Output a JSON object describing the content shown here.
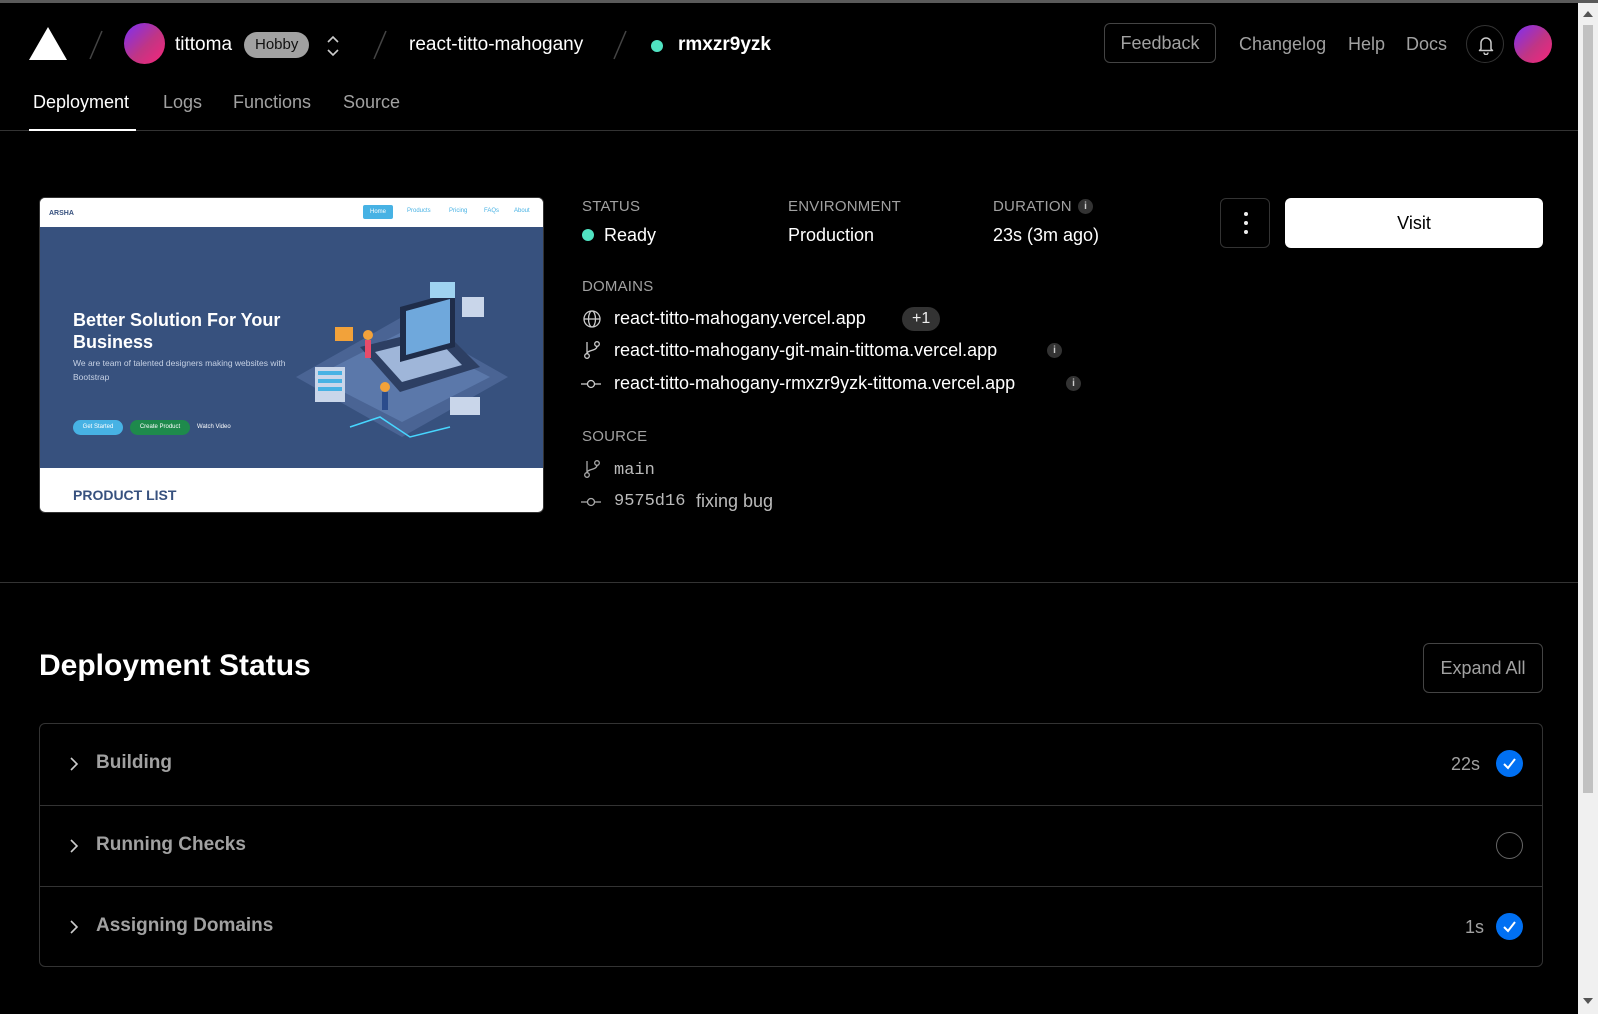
{
  "header": {
    "team": "tittoma",
    "plan_badge": "Hobby",
    "project": "react-titto-mahogany",
    "deployment_id": "rmxzr9yzk",
    "links": {
      "feedback": "Feedback",
      "changelog": "Changelog",
      "help": "Help",
      "docs": "Docs"
    }
  },
  "tabs": [
    "Deployment",
    "Logs",
    "Functions",
    "Source"
  ],
  "preview": {
    "brand": "ARSHA",
    "nav": [
      "Home",
      "Products",
      "Pricing",
      "FAQs",
      "About"
    ],
    "headline": "Better Solution For Your Business",
    "subtext": "We are team of talented designers making websites with Bootstrap",
    "buttons": [
      "Get Started",
      "Create Product",
      "Watch Video"
    ],
    "section": "PRODUCT LIST"
  },
  "details": {
    "status_label": "STATUS",
    "status_value": "Ready",
    "environment_label": "ENVIRONMENT",
    "environment_value": "Production",
    "duration_label": "DURATION",
    "duration_value": "23s (3m ago)",
    "domains_label": "DOMAINS",
    "domains": [
      "react-titto-mahogany.vercel.app",
      "react-titto-mahogany-git-main-tittoma.vercel.app",
      "react-titto-mahogany-rmxzr9yzk-tittoma.vercel.app"
    ],
    "extra_domains": "+1",
    "source_label": "SOURCE",
    "branch": "main",
    "commit_hash": "9575d16",
    "commit_message": "fixing bug",
    "info_icon_glyph": "i"
  },
  "actions": {
    "visit": "Visit"
  },
  "deployment_status": {
    "title": "Deployment Status",
    "expand_all": "Expand All",
    "steps": [
      {
        "name": "Building",
        "duration": "22s",
        "state": "complete"
      },
      {
        "name": "Running Checks",
        "duration": "",
        "state": "pending"
      },
      {
        "name": "Assigning Domains",
        "duration": "1s",
        "state": "complete"
      }
    ]
  },
  "colors": {
    "ready": "#50e3c2",
    "check": "#0070f3",
    "preview_hero": "#37517e"
  }
}
